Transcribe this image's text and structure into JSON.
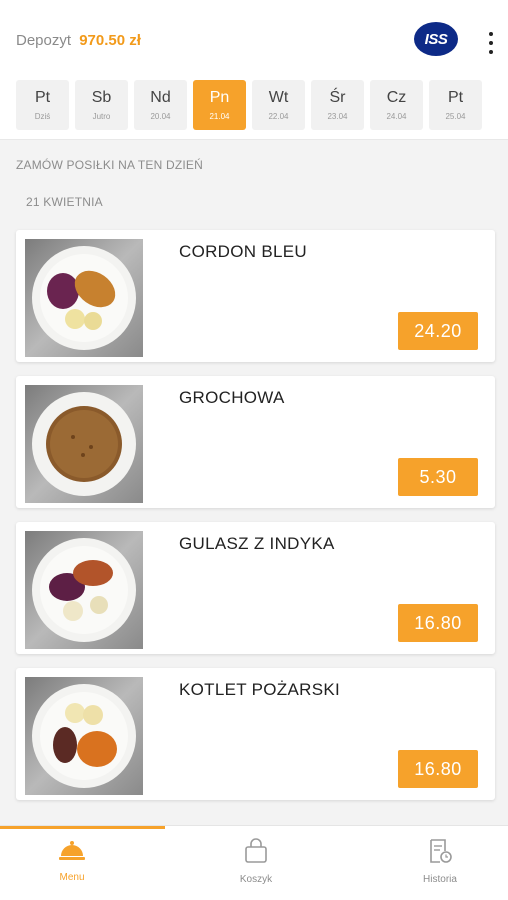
{
  "header": {
    "deposit_label": "Depozyt",
    "deposit_amount": "970.50 zł",
    "logo_text": "ISS",
    "brand_color": "#f6a22b",
    "logo_color": "#0d2a87"
  },
  "days": [
    {
      "abbr": "Pt",
      "sub": "Dziś",
      "active": false
    },
    {
      "abbr": "Sb",
      "sub": "Jutro",
      "active": false
    },
    {
      "abbr": "Nd",
      "sub": "20.04",
      "active": false
    },
    {
      "abbr": "Pn",
      "sub": "21.04",
      "active": true
    },
    {
      "abbr": "Wt",
      "sub": "22.04",
      "active": false
    },
    {
      "abbr": "Śr",
      "sub": "23.04",
      "active": false
    },
    {
      "abbr": "Cz",
      "sub": "24.04",
      "active": false
    },
    {
      "abbr": "Pt",
      "sub": "25.04",
      "active": false
    }
  ],
  "main": {
    "section_title": "ZAMÓW POSIŁKI NA TEN DZIEŃ",
    "date_title": "21 KWIETNIA",
    "dishes": [
      {
        "name": "CORDON BLEU",
        "price": "24.20"
      },
      {
        "name": "GROCHOWA",
        "price": "5.30"
      },
      {
        "name": "GULASZ Z INDYKA",
        "price": "16.80"
      },
      {
        "name": "KOTLET POŻARSKI",
        "price": "16.80"
      }
    ]
  },
  "nav": {
    "menu": "Menu",
    "cart": "Koszyk",
    "history": "Historia",
    "active": "menu",
    "icons": [
      "cloche-icon",
      "basket-icon",
      "history-icon"
    ]
  }
}
